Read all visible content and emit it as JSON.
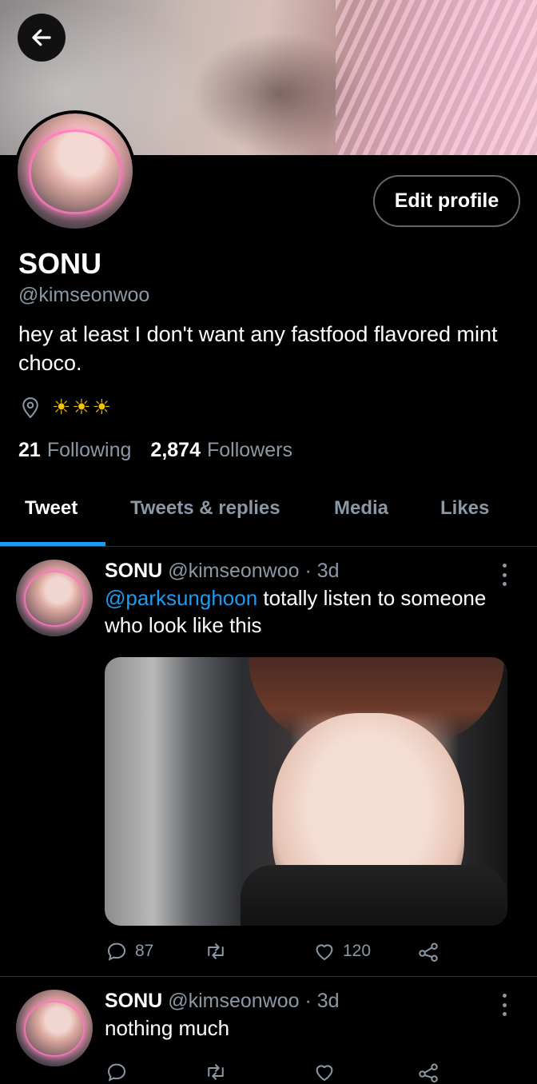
{
  "profile": {
    "name": "SONU",
    "handle": "@kimseonwoo",
    "bio": "hey at least I don't want any fastfood flavored mint choco.",
    "location": "☀☀☀",
    "following_count": "21",
    "following_label": "Following",
    "followers_count": "2,874",
    "followers_label": "Followers",
    "edit_label": "Edit profile"
  },
  "tabs": [
    {
      "label": "Tweet",
      "active": true
    },
    {
      "label": "Tweets & replies",
      "active": false
    },
    {
      "label": "Media",
      "active": false
    },
    {
      "label": "Likes",
      "active": false
    }
  ],
  "tweets": [
    {
      "name": "SONU",
      "handle": "@kimseonwoo",
      "time": "· 3d",
      "mention": "@parksunghoon",
      "text": " totally listen to someone who look like this",
      "replies": "87",
      "likes": "120"
    },
    {
      "name": "SONU",
      "handle": "@kimseonwoo",
      "time": "· 3d",
      "text": "nothing much"
    }
  ],
  "colors": {
    "accent": "#1d9bf0",
    "muted": "#8b98a5",
    "background": "#000000"
  },
  "icons": [
    "back-arrow-icon",
    "location-pin-icon",
    "reply-icon",
    "retweet-icon",
    "like-icon",
    "share-icon",
    "more-icon"
  ]
}
